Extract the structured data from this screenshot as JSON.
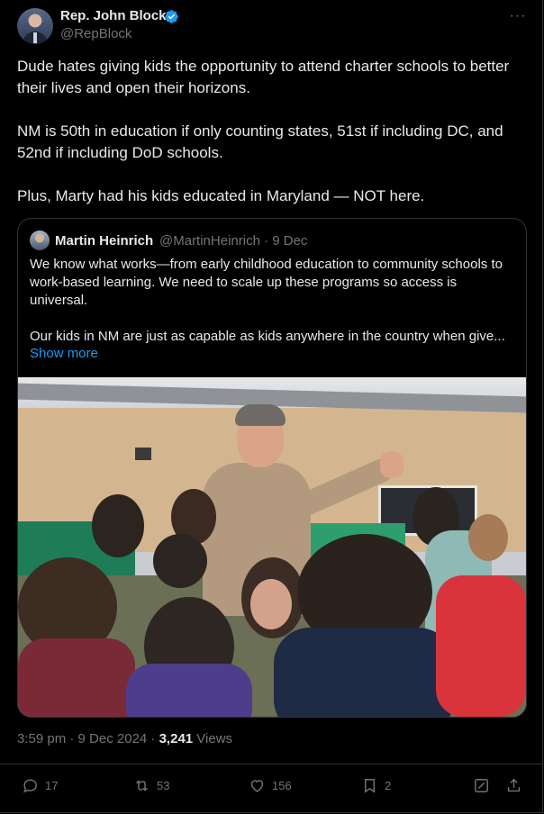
{
  "author": {
    "display_name": "Rep. John Block",
    "handle": "@RepBlock"
  },
  "tweet": {
    "paragraphs": [
      "Dude hates giving kids the opportunity to attend charter schools to better their lives and open their horizons.",
      "NM is 50th in education if only counting states, 51st if including DC, and 52nd if including DoD schools.",
      "Plus, Marty had his kids educated in Maryland — NOT here."
    ]
  },
  "quote": {
    "display_name": "Martin Heinrich",
    "handle_date": "@MartinHeinrich · 9 Dec",
    "paragraphs": [
      "We know what works—from early childhood education to community schools to work-based learning. We need to scale up these programs so access is universal.",
      "Our kids in NM are just as capable as kids anywhere in the country when give..."
    ],
    "show_more": "Show more"
  },
  "meta": {
    "time_date": "3:59 pm · 9 Dec 2024 · ",
    "views_count": "3,241",
    "views_label": " Views"
  },
  "actions": {
    "replies": "17",
    "reposts": "53",
    "likes": "156",
    "bookmarks": "2"
  },
  "colors": {
    "background": "#000000",
    "text": "#e7e9ea",
    "muted": "#71767b",
    "accent": "#1d9bf0",
    "border": "#2f3336"
  }
}
